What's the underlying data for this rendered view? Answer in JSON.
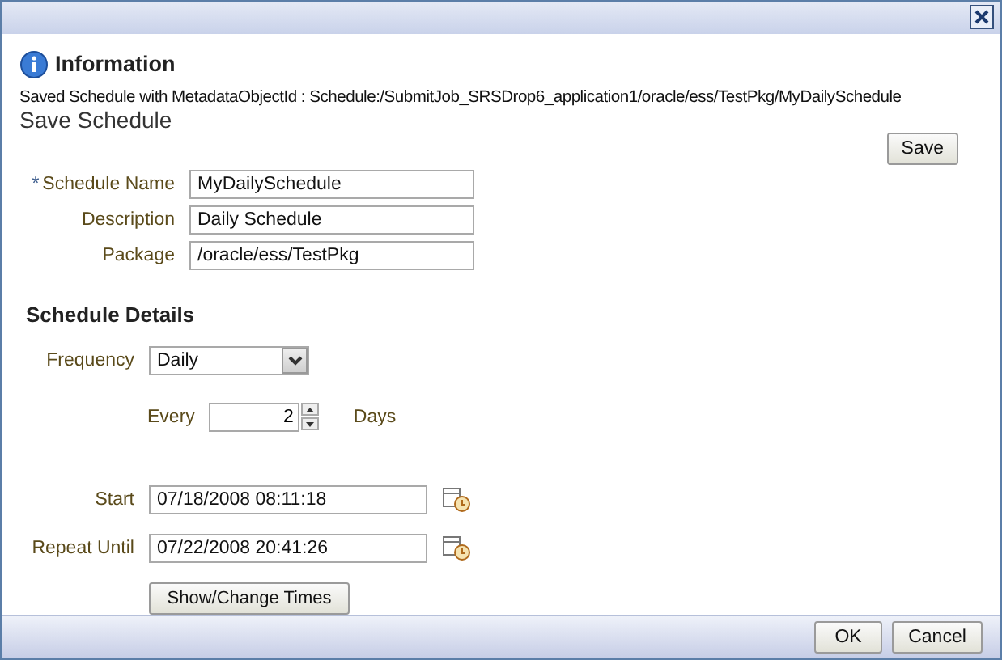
{
  "info": {
    "title": "Information",
    "message": "Saved Schedule with MetadataObjectId : Schedule:/SubmitJob_SRSDrop6_application1/oracle/ess/TestPkg/MyDailySchedule"
  },
  "section_title": "Save Schedule",
  "save_button": "Save",
  "fields": [
    {
      "label": "Schedule Name",
      "required_mark": "*",
      "value": "MyDailySchedule"
    },
    {
      "label": "Description",
      "value": "Daily Schedule"
    },
    {
      "label": "Package",
      "value": "/oracle/ess/TestPkg"
    }
  ],
  "details": {
    "title": "Schedule Details",
    "frequency_label": "Frequency",
    "frequency": "Daily",
    "every_label": "Every",
    "every_value": "2",
    "every_unit": "Days",
    "start_label": "Start",
    "start": "07/18/2008 08:11:18",
    "repeat_label": "Repeat Until",
    "repeat": "07/22/2008 20:41:26",
    "times_button": "Show/Change Times"
  },
  "footer_buttons": [
    "OK",
    "Cancel"
  ]
}
